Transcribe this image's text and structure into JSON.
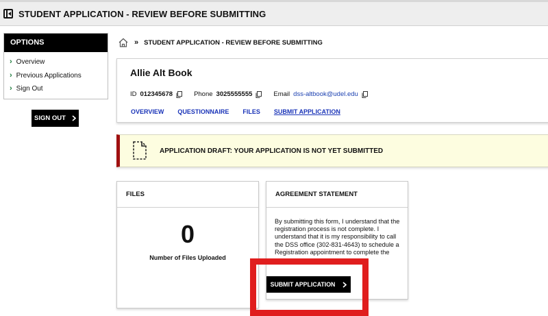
{
  "header": {
    "title": "STUDENT APPLICATION - REVIEW BEFORE SUBMITTING"
  },
  "sidebar": {
    "heading": "OPTIONS",
    "items": [
      {
        "label": "Overview"
      },
      {
        "label": "Previous Applications"
      },
      {
        "label": "Sign Out"
      }
    ]
  },
  "signout_button": {
    "label": "SIGN OUT"
  },
  "breadcrumb": {
    "sep": "»",
    "current": "STUDENT APPLICATION - REVIEW BEFORE SUBMITTING"
  },
  "profile": {
    "name": "Allie Alt Book",
    "id_label": "ID",
    "id_value": "012345678",
    "phone_label": "Phone",
    "phone_value": "3025555555",
    "email_label": "Email",
    "email_value": "dss-altbook@udel.edu",
    "links": [
      {
        "label": "OVERVIEW"
      },
      {
        "label": "QUESTIONNAIRE"
      },
      {
        "label": "FILES"
      },
      {
        "label": "SUBMIT APPLICATION"
      }
    ]
  },
  "notice": {
    "text": "APPLICATION DRAFT: YOUR APPLICATION IS NOT YET SUBMITTED"
  },
  "files_card": {
    "title": "FILES",
    "count": "0",
    "caption": "Number of Files Uploaded"
  },
  "agreement_card": {
    "title": "AGREEMENT STATEMENT",
    "body": "By submitting this form, I understand that the registration process is not complete. I understand that it is my responsibility to call the DSS office (302-831-4643) to schedule a Registration appointment to complete the process."
  },
  "submit_button": {
    "label": "SUBMIT APPLICATION"
  },
  "colors": {
    "accent_red": "#e01e1e",
    "link_blue": "#1a34b8",
    "notice_bg": "#fdfde0",
    "notice_border": "#a01010"
  }
}
